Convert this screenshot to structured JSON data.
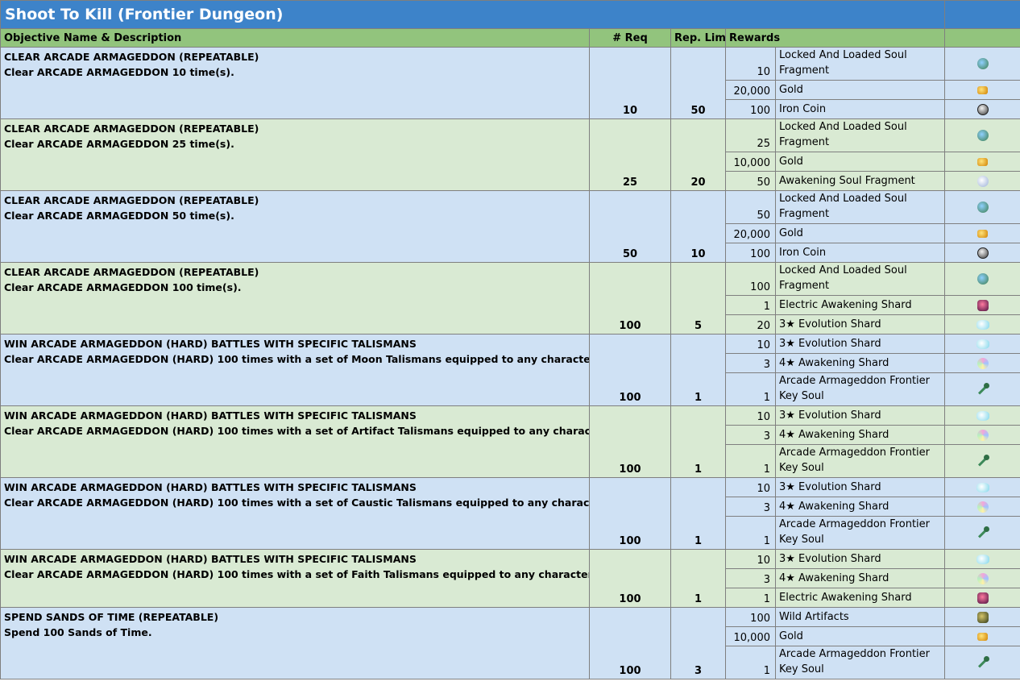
{
  "title": "Shoot To Kill (Frontier Dungeon)",
  "headers": {
    "objective": "Objective Name & Description",
    "req": "# Req",
    "limit": "Rep. Limit",
    "rewards": "Rewards"
  },
  "objectives": [
    {
      "name": "CLEAR ARCADE ARMAGEDDON (REPEATABLE)",
      "desc": "Clear ARCADE ARMAGEDDON 10 time(s).",
      "req": "10",
      "limit": "50",
      "rewards": [
        {
          "qty": "10",
          "item": "Locked And Loaded Soul Fragment",
          "icon": "soul-fragment-icon"
        },
        {
          "qty": "20,000",
          "item": "Gold",
          "icon": "gold-icon"
        },
        {
          "qty": "100",
          "item": "Iron Coin",
          "icon": "iron-coin-icon"
        }
      ]
    },
    {
      "name": "CLEAR ARCADE ARMAGEDDON (REPEATABLE)",
      "desc": "Clear ARCADE ARMAGEDDON 25 time(s).",
      "req": "25",
      "limit": "20",
      "rewards": [
        {
          "qty": "25",
          "item": "Locked And Loaded Soul Fragment",
          "icon": "soul-fragment-icon"
        },
        {
          "qty": "10,000",
          "item": "Gold",
          "icon": "gold-icon"
        },
        {
          "qty": "50",
          "item": "Awakening Soul Fragment",
          "icon": "awakening-soul-fragment-icon"
        }
      ]
    },
    {
      "name": "CLEAR ARCADE ARMAGEDDON (REPEATABLE)",
      "desc": "Clear ARCADE ARMAGEDDON 50 time(s).",
      "req": "50",
      "limit": "10",
      "rewards": [
        {
          "qty": "50",
          "item": "Locked And Loaded Soul Fragment",
          "icon": "soul-fragment-icon"
        },
        {
          "qty": "20,000",
          "item": "Gold",
          "icon": "gold-icon"
        },
        {
          "qty": "100",
          "item": "Iron Coin",
          "icon": "iron-coin-icon"
        }
      ]
    },
    {
      "name": "CLEAR ARCADE ARMAGEDDON (REPEATABLE)",
      "desc": "Clear ARCADE ARMAGEDDON 100 time(s).",
      "req": "100",
      "limit": "5",
      "rewards": [
        {
          "qty": "100",
          "item": "Locked And Loaded Soul Fragment",
          "icon": "soul-fragment-icon"
        },
        {
          "qty": "1",
          "item": "Electric Awakening Shard",
          "icon": "electric-awakening-shard-icon"
        },
        {
          "qty": "20",
          "item": "3★ Evolution Shard",
          "icon": "evolution-shard-icon"
        }
      ]
    },
    {
      "name": "WIN ARCADE ARMAGEDDON (HARD) BATTLES WITH SPECIFIC TALISMANS",
      "desc": "Clear ARCADE ARMAGEDDON (HARD) 100 times with a set of Moon Talismans equipped to any character.",
      "req": "100",
      "limit": "1",
      "rewards": [
        {
          "qty": "10",
          "item": "3★ Evolution Shard",
          "icon": "evolution-shard-icon"
        },
        {
          "qty": "3",
          "item": "4★ Awakening Shard",
          "icon": "awakening-shard-icon"
        },
        {
          "qty": "1",
          "item": "Arcade Armageddon Frontier Key Soul",
          "icon": "key-soul-icon"
        }
      ]
    },
    {
      "name": "WIN ARCADE ARMAGEDDON (HARD) BATTLES WITH SPECIFIC TALISMANS",
      "desc": "Clear ARCADE ARMAGEDDON (HARD) 100 times with a set of Artifact Talismans equipped to any character.",
      "req": "100",
      "limit": "1",
      "rewards": [
        {
          "qty": "10",
          "item": "3★ Evolution Shard",
          "icon": "evolution-shard-icon"
        },
        {
          "qty": "3",
          "item": "4★ Awakening Shard",
          "icon": "awakening-shard-icon"
        },
        {
          "qty": "1",
          "item": "Arcade Armageddon Frontier Key Soul",
          "icon": "key-soul-icon"
        }
      ]
    },
    {
      "name": "WIN ARCADE ARMAGEDDON (HARD) BATTLES WITH SPECIFIC TALISMANS",
      "desc": "Clear ARCADE ARMAGEDDON (HARD) 100 times with a set of Caustic Talismans equipped to any character.",
      "req": "100",
      "limit": "1",
      "rewards": [
        {
          "qty": "10",
          "item": "3★ Evolution Shard",
          "icon": "evolution-shard-icon"
        },
        {
          "qty": "3",
          "item": "4★ Awakening Shard",
          "icon": "awakening-shard-icon"
        },
        {
          "qty": "1",
          "item": "Arcade Armageddon Frontier Key Soul",
          "icon": "key-soul-icon"
        }
      ]
    },
    {
      "name": "WIN ARCADE ARMAGEDDON (HARD) BATTLES WITH SPECIFIC TALISMANS",
      "desc": "Clear ARCADE ARMAGEDDON (HARD) 100 times with a set of Faith Talismans equipped to any character.",
      "req": "100",
      "limit": "1",
      "rewards": [
        {
          "qty": "10",
          "item": "3★ Evolution Shard",
          "icon": "evolution-shard-icon"
        },
        {
          "qty": "3",
          "item": "4★ Awakening Shard",
          "icon": "awakening-shard-icon"
        },
        {
          "qty": "1",
          "item": "Electric Awakening Shard",
          "icon": "electric-awakening-shard-icon"
        }
      ]
    },
    {
      "name": "SPEND SANDS OF TIME (REPEATABLE)",
      "desc": "Spend 100 Sands of Time.",
      "req": "100",
      "limit": "3",
      "rewards": [
        {
          "qty": "100",
          "item": "Wild Artifacts",
          "icon": "wild-artifacts-icon"
        },
        {
          "qty": "10,000",
          "item": "Gold",
          "icon": "gold-icon"
        },
        {
          "qty": "1",
          "item": "Arcade Armageddon Frontier Key Soul",
          "icon": "key-soul-icon"
        }
      ]
    }
  ]
}
